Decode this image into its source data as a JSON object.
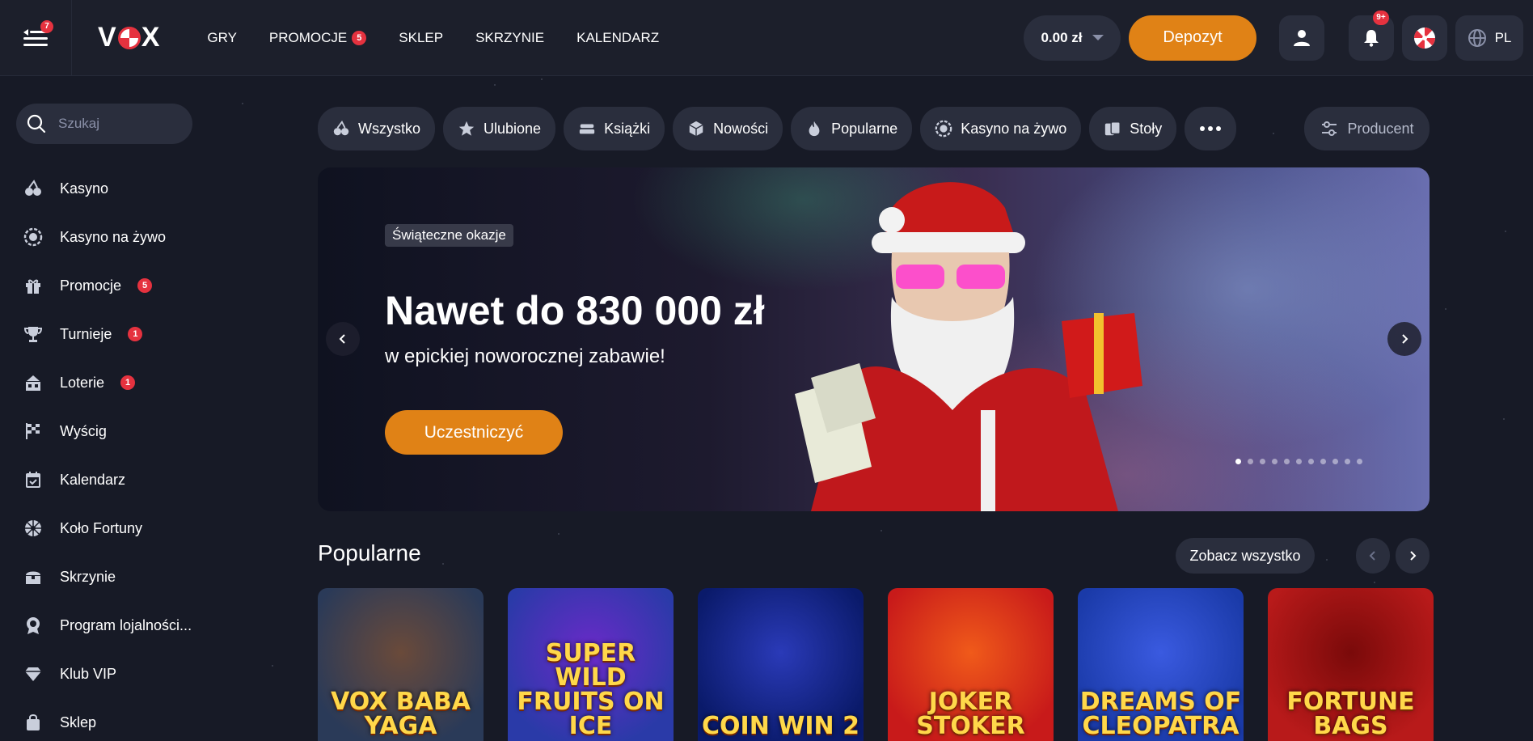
{
  "header": {
    "menu_badge": "7",
    "logo": "VOX",
    "nav": [
      {
        "label": "GRY",
        "badge": ""
      },
      {
        "label": "PROMOCJE",
        "badge": "5"
      },
      {
        "label": "SKLEP",
        "badge": ""
      },
      {
        "label": "SKRZYNIE",
        "badge": ""
      },
      {
        "label": "KALENDARZ",
        "badge": ""
      }
    ],
    "balance": "0.00 zł",
    "deposit_label": "Depozyt",
    "notifications_badge": "9+",
    "language": "PL"
  },
  "sidebar": {
    "search_placeholder": "Szukaj",
    "items": [
      {
        "label": "Kasyno",
        "icon": "cherries-icon",
        "badge": ""
      },
      {
        "label": "Kasyno na żywo",
        "icon": "live-chip-icon",
        "badge": ""
      },
      {
        "label": "Promocje",
        "icon": "gift-icon",
        "badge": "5"
      },
      {
        "label": "Turnieje",
        "icon": "trophy-icon",
        "badge": "1"
      },
      {
        "label": "Loterie",
        "icon": "lottery-icon",
        "badge": "1"
      },
      {
        "label": "Wyścig",
        "icon": "race-flag-icon",
        "badge": ""
      },
      {
        "label": "Kalendarz",
        "icon": "calendar-icon",
        "badge": ""
      },
      {
        "label": "Koło Fortuny",
        "icon": "wheel-icon",
        "badge": ""
      },
      {
        "label": "Skrzynie",
        "icon": "chest-icon",
        "badge": ""
      },
      {
        "label": "Program lojalności...",
        "icon": "loyalty-icon",
        "badge": ""
      },
      {
        "label": "Klub VIP",
        "icon": "diamond-icon",
        "badge": ""
      },
      {
        "label": "Sklep",
        "icon": "shopping-bag-icon",
        "badge": ""
      }
    ]
  },
  "filters": {
    "chips": [
      {
        "label": "Wszystko",
        "icon": "cherries-icon"
      },
      {
        "label": "Ulubione",
        "icon": "star-icon"
      },
      {
        "label": "Książki",
        "icon": "books-icon"
      },
      {
        "label": "Nowości",
        "icon": "cube-icon"
      },
      {
        "label": "Popularne",
        "icon": "fire-icon"
      },
      {
        "label": "Kasyno na żywo",
        "icon": "live-chip-icon"
      },
      {
        "label": "Stoły",
        "icon": "cards-icon"
      }
    ],
    "producer_label": "Producent"
  },
  "banner": {
    "tag": "Świąteczne okazje",
    "title": "Nawet do 830 000 zł",
    "subtitle": "w epickiej noworocznej zabawie!",
    "cta": "Uczestniczyć",
    "slide_count": 11,
    "active_slide": 1
  },
  "popular": {
    "title": "Popularne",
    "see_all": "Zobacz wszystko",
    "games": [
      {
        "name": "Vox Baba Yaga",
        "colors": [
          "#2a3a58",
          "#6a4a3a"
        ]
      },
      {
        "name": "Super Wild Fruits On Ice",
        "colors": [
          "#2a3aa8",
          "#6a2ac8"
        ]
      },
      {
        "name": "Coin Win 2",
        "colors": [
          "#0a1a6a",
          "#2a3ab8"
        ]
      },
      {
        "name": "Joker Stoker",
        "colors": [
          "#c81a1a",
          "#f05a1a"
        ]
      },
      {
        "name": "Dreams of Cleopatra",
        "colors": [
          "#1a3aa8",
          "#3a5ae0"
        ]
      },
      {
        "name": "Fortune Bags",
        "colors": [
          "#b81a1a",
          "#7a0a0a"
        ]
      }
    ]
  },
  "colors": {
    "accent": "#e08216",
    "badge": "#e5323f",
    "background": "#171a26",
    "surface": "#2a2e3d"
  }
}
